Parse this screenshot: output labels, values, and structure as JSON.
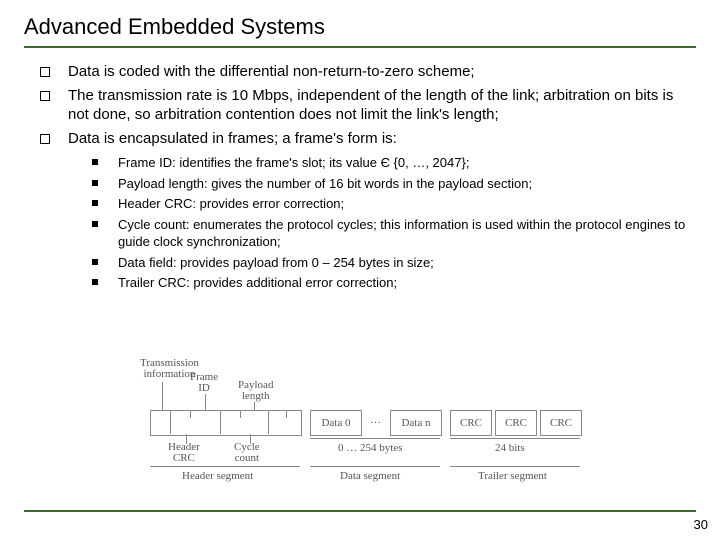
{
  "title": "Advanced Embedded Systems",
  "bullets": {
    "b1": "Data is coded with the differential non-return-to-zero scheme;",
    "b2": "The transmission rate is 10 Mbps, independent of the length of the link; arbitration on bits is not done, so arbitration contention does not limit the link's length;",
    "b3": "Data is encapsulated in frames; a frame's form is:"
  },
  "sub": {
    "s1": "Frame ID: identifies the frame's slot; its value Є {0, …, 2047};",
    "s2": "Payload length: gives the number of 16 bit words in the payload section;",
    "s3": "Header CRC: provides error correction;",
    "s4": "Cycle count: enumerates the protocol cycles; this information is used within the protocol engines to guide clock synchronization;",
    "s5": "Data field: provides payload from 0 – 254 bytes in size;",
    "s6": "Trailer CRC: provides additional error correction;"
  },
  "diagram": {
    "top_labels": {
      "trans_info": "Transmission\ninformation",
      "frame_id": "Frame\nID",
      "payload_len": "Payload\nlength"
    },
    "row_labels": {
      "data0": "Data 0",
      "dots": "…",
      "datan": "Data n",
      "crc": "CRC"
    },
    "bottom_labels": {
      "header_crc": "Header\nCRC",
      "cycle_count": "Cycle\ncount",
      "bytes": "0 … 254 bytes",
      "bits24": "24 bits"
    },
    "segments": {
      "header": "Header segment",
      "data": "Data segment",
      "trailer": "Trailer segment"
    }
  },
  "page_number": "30"
}
